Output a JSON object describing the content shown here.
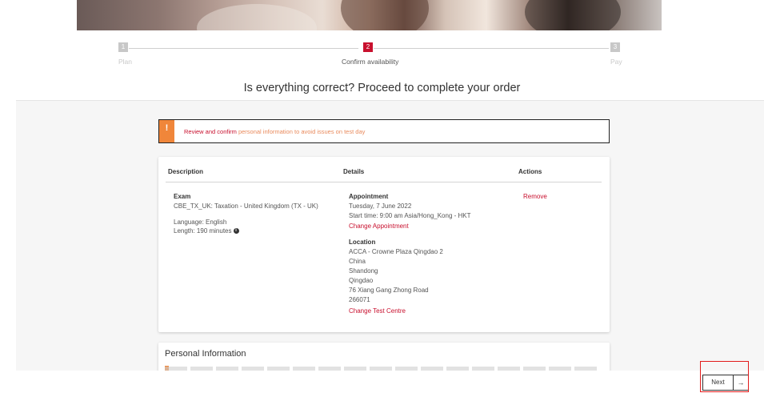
{
  "stepper": {
    "steps": [
      {
        "number": "1",
        "label": "Plan"
      },
      {
        "number": "2",
        "label": "Confirm availability"
      },
      {
        "number": "3",
        "label": "Pay"
      }
    ],
    "active_step": 2
  },
  "heading": "Is everything correct? Proceed to complete your order",
  "alert": {
    "icon": "!",
    "strong": "Review and confirm",
    "rest": " personal information to avoid issues on test day"
  },
  "table": {
    "headers": {
      "description": "Description",
      "details": "Details",
      "actions": "Actions"
    },
    "exam": {
      "title": "Exam",
      "name": "CBE_TX_UK: Taxation - United Kingdom (TX - UK)",
      "language": "Language: English",
      "length": "Length: 190 minutes"
    },
    "appointment": {
      "title": "Appointment",
      "date": "Tuesday, 7 June 2022",
      "start_time": "Start time: 9:00 am Asia/Hong_Kong - HKT",
      "change_link": "Change Appointment"
    },
    "location": {
      "title": "Location",
      "lines": [
        "ACCA - Crowne Plaza Qingdao 2",
        "China",
        "Shandong",
        "Qingdao",
        "76 Xiang Gang Zhong Road",
        "266071"
      ],
      "change_link": "Change Test Centre"
    },
    "remove_label": "Remove"
  },
  "personal_info": {
    "title": "Personal Information"
  },
  "footer": {
    "next_label": "Next",
    "next_arrow": "→"
  },
  "colors": {
    "brand_red": "#c8102e",
    "warning_orange": "#f0863a",
    "highlight_red": "#e21b1b"
  }
}
